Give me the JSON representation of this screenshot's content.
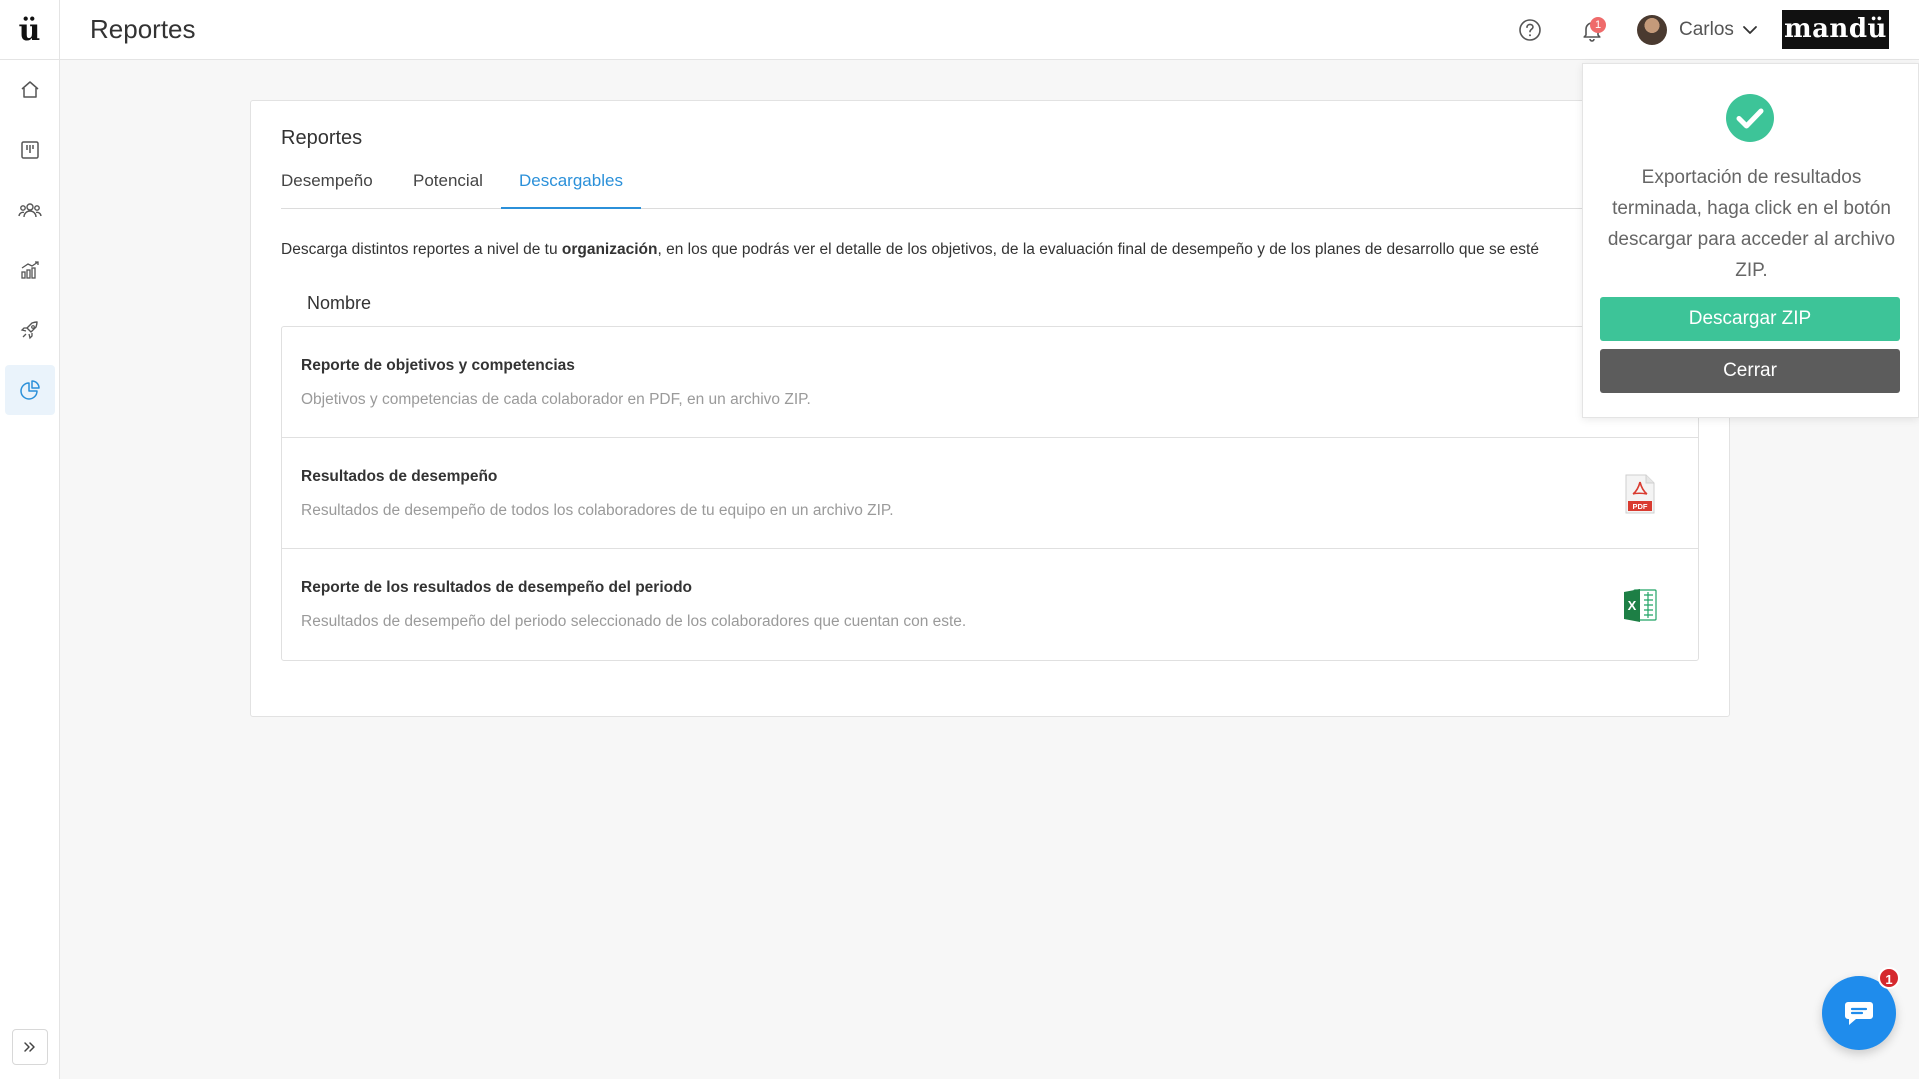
{
  "header": {
    "logo_text": "ü",
    "title": "Reportes",
    "help_icon": "question-circle-icon",
    "notifications": {
      "icon": "bell-icon",
      "count": "1"
    },
    "user": {
      "name": "Carlos",
      "avatar": "user-avatar"
    },
    "brand": "mandü"
  },
  "sidebar": {
    "items": [
      {
        "icon": "home-icon"
      },
      {
        "icon": "board-icon"
      },
      {
        "icon": "users-icon"
      },
      {
        "icon": "chart-growth-icon"
      },
      {
        "icon": "rocket-icon"
      },
      {
        "icon": "pie-chart-icon",
        "active": true
      }
    ],
    "expand_icon": "double-chevron-right-icon"
  },
  "main": {
    "card_title": "Reportes",
    "tabs": [
      {
        "label": "Desempeño"
      },
      {
        "label": "Potencial"
      },
      {
        "label": "Descargables",
        "active": true
      }
    ],
    "description_prefix": "Descarga distintos reportes a nivel de tu ",
    "description_bold": "organización",
    "description_suffix": ", en los que podrás ver el detalle de los objetivos, de la evaluación final de desempeño y de los planes de desarrollo que se esté",
    "column_header": "Nombre",
    "reports": [
      {
        "title": "Reporte de objetivos y competencias",
        "subtitle": "Objetivos y competencias de cada colaborador en PDF, en un archivo ZIP.",
        "icon": "none"
      },
      {
        "title": "Resultados de desempeño",
        "subtitle": "Resultados de desempeño de todos los colaboradores de tu equipo en un archivo ZIP.",
        "icon": "pdf-file-icon",
        "icon_label": "PDF"
      },
      {
        "title": "Reporte de los resultados de desempeño del periodo",
        "subtitle": "Resultados de desempeño del periodo seleccionado de los colaboradores que cuentan con este.",
        "icon": "excel-file-icon",
        "icon_label": "X"
      }
    ]
  },
  "notification_panel": {
    "icon": "check-circle-icon",
    "message": "Exportación de resultados terminada, haga click en el botón descargar para acceder al archivo ZIP.",
    "primary_button": "Descargar ZIP",
    "secondary_button": "Cerrar"
  },
  "chat": {
    "icon": "chat-icon",
    "badge": "1"
  },
  "colors": {
    "accent": "#2b90d9",
    "success": "#3dc498",
    "secondary_button": "#5c5c5c",
    "chat": "#1f8cec",
    "badge": "#d5282d"
  }
}
